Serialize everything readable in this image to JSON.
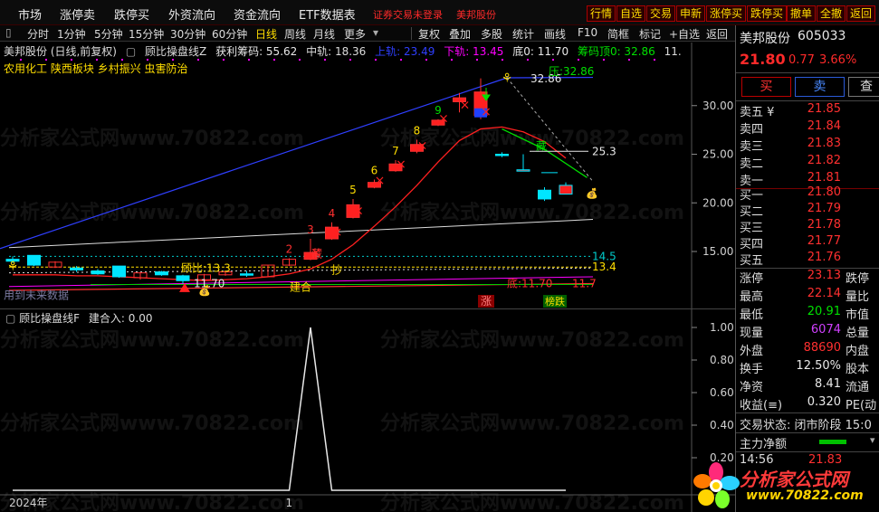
{
  "menu": {
    "items": [
      "市场",
      "涨停卖",
      "跌停买",
      "外资流向",
      "资金流向",
      "ETF数据表"
    ],
    "warn": "证券交易未登录",
    "stock_name": "美邦股份",
    "right_buttons": [
      "行情",
      "自选",
      "交易",
      "申新",
      "涨停买",
      "跌停买",
      "撤单",
      "全撤",
      "返回"
    ]
  },
  "toolbar": {
    "left": [
      "分时",
      "1分钟",
      "5分钟",
      "15分钟",
      "30分钟",
      "60分钟",
      "日线",
      "周线",
      "月线",
      "更多"
    ],
    "right": [
      "复权",
      "叠加",
      "多股",
      "统计",
      "画线",
      "F10",
      "简框",
      "标记",
      "+自选",
      "返回"
    ],
    "selected": "日线"
  },
  "header": {
    "title": "美邦股份 (日线,前复权)",
    "indicator": "顾比操盘线Z",
    "profit_chip": "获利筹码: 55.62",
    "mid_rail": "中轨: 18.36",
    "upper_rail": "上轨: 23.49",
    "lower_rail": "下轨: 13.45",
    "bottom": "底0: 11.70",
    "chip_top": "筹码顶0: 32.86",
    "more": "11."
  },
  "sectors": [
    "农用化工",
    "陕西板块",
    "乡村振兴",
    "虫害防治"
  ],
  "main_chart": {
    "y_ticks": [
      30.0,
      25.0,
      20.0,
      15.0
    ],
    "y_tick_labels": [
      "30.00",
      "25.00",
      "20.00",
      "15.00"
    ],
    "annotations": {
      "top_price": "32.86",
      "pressure": "压:32.86",
      "level_25": "25.3",
      "level_14": "14.5",
      "level_13": "13.4",
      "gubi": "顾比:13.3",
      "bottom_price": "11.70",
      "bottom_right": "11.7",
      "support_low": "底:11.70",
      "jianhe": "建合",
      "zhang": "涨",
      "bangdie": "榜跌",
      "cang": "藏",
      "chao": "抄",
      "weilai": "用到未来数据",
      "dollar": "$"
    },
    "step_numbers": [
      "2",
      "3",
      "4",
      "5",
      "6",
      "7",
      "8",
      "9"
    ],
    "candles": [
      {
        "o": 14.2,
        "c": 14.0,
        "h": 14.5,
        "l": 13.8
      },
      {
        "o": 14.6,
        "c": 13.6,
        "h": 14.6,
        "l": 13.5
      },
      {
        "o": 13.4,
        "c": 13.9,
        "h": 14.0,
        "l": 13.3
      },
      {
        "o": 13.3,
        "c": 13.1,
        "h": 13.5,
        "l": 12.9
      },
      {
        "o": 13.0,
        "c": 12.7,
        "h": 13.2,
        "l": 12.6
      },
      {
        "o": 13.5,
        "c": 12.4,
        "h": 13.5,
        "l": 12.3
      },
      {
        "o": 12.3,
        "c": 12.8,
        "h": 12.9,
        "l": 12.1
      },
      {
        "o": 12.9,
        "c": 12.6,
        "h": 13.0,
        "l": 12.5
      },
      {
        "o": 12.5,
        "c": 12.0,
        "h": 12.6,
        "l": 11.7
      },
      {
        "o": 12.1,
        "c": 12.6,
        "h": 12.7,
        "l": 12.0
      },
      {
        "o": 12.6,
        "c": 12.9,
        "h": 13.0,
        "l": 12.5
      },
      {
        "o": 12.7,
        "c": 12.6,
        "h": 13.0,
        "l": 12.4
      },
      {
        "o": 12.4,
        "c": 13.6,
        "h": 13.6,
        "l": 12.4
      },
      {
        "o": 13.6,
        "c": 14.2,
        "h": 14.3,
        "l": 13.5
      },
      {
        "o": 14.2,
        "c": 14.9,
        "h": 16.3,
        "l": 14.1
      },
      {
        "o": 16.3,
        "c": 17.5,
        "h": 18.0,
        "l": 16.2
      },
      {
        "o": 18.5,
        "c": 19.8,
        "h": 20.4,
        "l": 18.4
      },
      {
        "o": 21.6,
        "c": 22.1,
        "h": 22.4,
        "l": 21.5
      },
      {
        "o": 23.3,
        "c": 24.0,
        "h": 24.4,
        "l": 23.2
      },
      {
        "o": 25.3,
        "c": 26.0,
        "h": 26.5,
        "l": 25.1
      },
      {
        "o": 28.0,
        "c": 28.5,
        "h": 28.6,
        "l": 27.9
      },
      {
        "o": 30.4,
        "c": 30.8,
        "h": 31.3,
        "l": 29.3
      },
      {
        "o": 29.0,
        "c": 31.4,
        "h": 32.8,
        "l": 28.6
      },
      {
        "o": 25.0,
        "c": 24.9,
        "h": 25.2,
        "l": 24.7
      },
      {
        "o": 23.4,
        "c": 23.4,
        "h": 25.0,
        "l": 23.4
      },
      {
        "o": 21.3,
        "c": 20.4,
        "h": 21.6,
        "l": 20.2
      },
      {
        "o": 20.9,
        "c": 21.8,
        "h": 22.1,
        "l": 20.9
      }
    ]
  },
  "sub_chart": {
    "title": "顾比操盘线F",
    "value": "建合入: 0.00",
    "y_ticks": [
      1.0,
      0.8,
      0.6,
      0.4,
      0.2
    ],
    "y_tick_labels": [
      "1.00",
      "0.80",
      "0.60",
      "0.40",
      "0.20"
    ],
    "x_label": "2024年",
    "x_mark": "1",
    "series": [
      0,
      0,
      0,
      0,
      0,
      0,
      0,
      0,
      0,
      0,
      0,
      0,
      0,
      0,
      1,
      0,
      0,
      0,
      0,
      0,
      0,
      0,
      0,
      0,
      0,
      0,
      0
    ]
  },
  "quote": {
    "name": "美邦股份",
    "code": "605033",
    "price": "21.80",
    "change": "0.77",
    "pct": "3.66%",
    "buy_btn": "买",
    "sell_btn": "卖",
    "more_btn": "查",
    "asks": [
      {
        "label": "卖五 ¥",
        "price": "21.85"
      },
      {
        "label": "卖四",
        "price": "21.84"
      },
      {
        "label": "卖三",
        "price": "21.83"
      },
      {
        "label": "卖二",
        "price": "21.82"
      },
      {
        "label": "卖一",
        "price": "21.81"
      }
    ],
    "bids": [
      {
        "label": "买一",
        "price": "21.80"
      },
      {
        "label": "买二",
        "price": "21.79"
      },
      {
        "label": "买三",
        "price": "21.78"
      },
      {
        "label": "买四",
        "price": "21.77"
      },
      {
        "label": "买五",
        "price": "21.76"
      }
    ],
    "stats": [
      {
        "label": "涨停",
        "value": "23.13",
        "color": "#ff3030",
        "label2": "跌停"
      },
      {
        "label": "最高",
        "value": "22.14",
        "color": "#ff3030",
        "label2": "量比"
      },
      {
        "label": "最低",
        "value": "20.91",
        "color": "#00e000",
        "label2": "市值"
      },
      {
        "label": "现量",
        "value": "6074",
        "color": "#d040ff",
        "label2": "总量"
      },
      {
        "label": "外盘",
        "value": "88690",
        "color": "#ff3030",
        "label2": "内盘"
      },
      {
        "label": "换手",
        "value": "12.50%",
        "color": "#e8e8e8",
        "label2": "股本"
      },
      {
        "label": "净资",
        "value": "8.41",
        "color": "#e8e8e8",
        "label2": "流通"
      },
      {
        "label": "收益(≡)",
        "value": "0.320",
        "color": "#e8e8e8",
        "label2": "PE(动"
      }
    ],
    "trade_state": "交易状态: 闭市阶段 15:0",
    "main_flow": "主力净额",
    "tick_time": "14:56",
    "tick_price": "21.83"
  },
  "watermark": "分析家公式网www.70822.com",
  "logo": {
    "title": "分析家公式网",
    "url": "www.70822.com"
  },
  "colors": {
    "red": "#ff2a2a",
    "green": "#00e000",
    "yellow": "#ffde00",
    "cyan": "#00ffff",
    "magenta": "#ff00ff",
    "blue": "#2f3fff"
  }
}
